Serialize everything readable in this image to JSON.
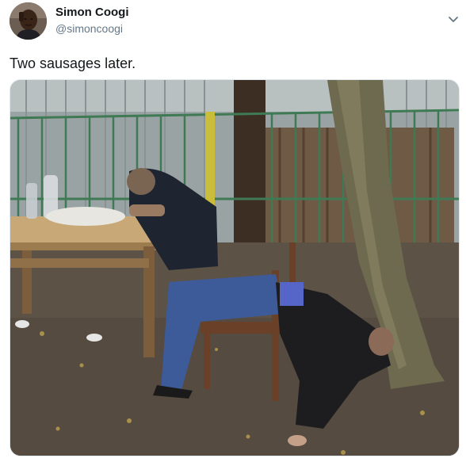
{
  "tweet": {
    "author": {
      "display_name": "Simon Coogi",
      "handle": "@simoncoogi"
    },
    "text": "Two sausages later.",
    "icons": {
      "avatar": "profile-photo",
      "menu": "chevron-down-icon",
      "media": "photo-two-men-passed-out-outdoors"
    },
    "colors": {
      "name": "#14171a",
      "handle": "#657786",
      "caret": "#657786",
      "border": "#e1e8ed"
    }
  }
}
